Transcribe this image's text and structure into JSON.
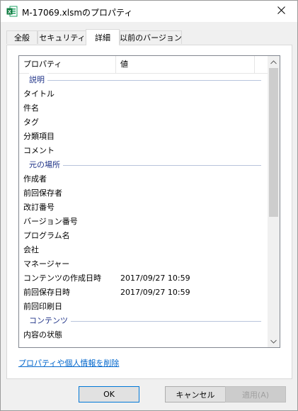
{
  "window": {
    "title": "M-17069.xlsmのプロパティ"
  },
  "tabs": [
    {
      "label": "全般"
    },
    {
      "label": "セキュリティ"
    },
    {
      "label": "詳細"
    },
    {
      "label": "以前のバージョン"
    }
  ],
  "list": {
    "header": {
      "property": "プロパティ",
      "value": "値"
    },
    "items": [
      {
        "group": "説明"
      },
      {
        "property": "タイトル",
        "value": ""
      },
      {
        "property": "件名",
        "value": ""
      },
      {
        "property": "タグ",
        "value": ""
      },
      {
        "property": "分類項目",
        "value": ""
      },
      {
        "property": "コメント",
        "value": ""
      },
      {
        "group": "元の場所"
      },
      {
        "property": "作成者",
        "value": ""
      },
      {
        "property": "前回保存者",
        "value": ""
      },
      {
        "property": "改訂番号",
        "value": ""
      },
      {
        "property": "バージョン番号",
        "value": ""
      },
      {
        "property": "プログラム名",
        "value": ""
      },
      {
        "property": "会社",
        "value": ""
      },
      {
        "property": "マネージャー",
        "value": ""
      },
      {
        "property": "コンテンツの作成日時",
        "value": "2017/09/27 10:59"
      },
      {
        "property": "前回保存日時",
        "value": "2017/09/27 10:59"
      },
      {
        "property": "前回印刷日",
        "value": ""
      },
      {
        "group": "コンテンツ"
      },
      {
        "property": "内容の状態",
        "value": ""
      }
    ]
  },
  "links": {
    "remove_properties": "プロパティや個人情報を削除"
  },
  "buttons": {
    "ok": "OK",
    "cancel": "キャンセル",
    "apply": "適用(A)"
  }
}
